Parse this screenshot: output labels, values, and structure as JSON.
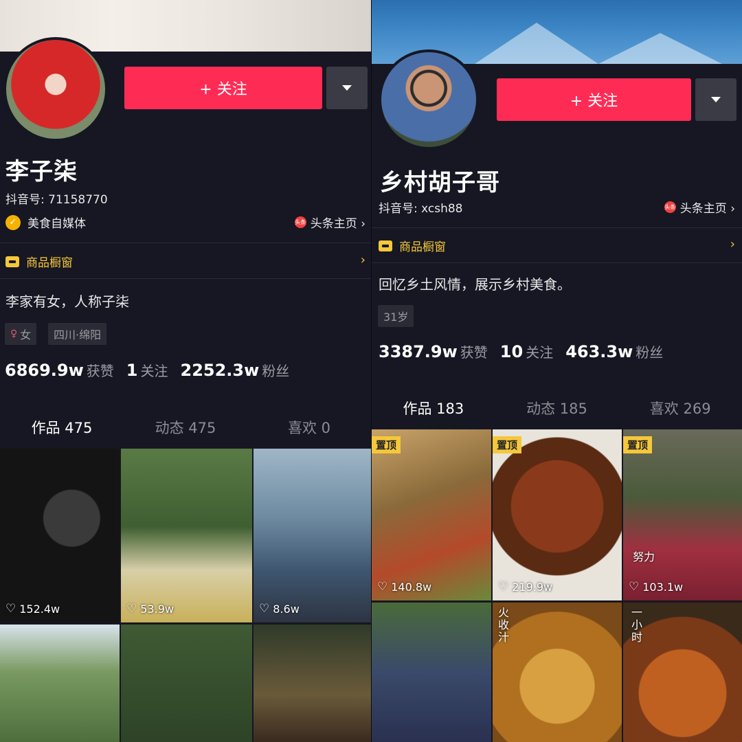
{
  "left": {
    "follow_label": "+ 关注",
    "name": "李子柒",
    "douyin_id": "抖音号: 71158770",
    "certification": "美食自媒体",
    "toutiao_label": "头条主页 ›",
    "toutiao_icon_text": "头条",
    "shop_label": "商品橱窗",
    "bio": "李家有女，人称子柒",
    "tags": [
      "女",
      "四川·绵阳"
    ],
    "stats": [
      {
        "num": "6869.9w",
        "label": "获赞"
      },
      {
        "num": "1",
        "label": "关注"
      },
      {
        "num": "2252.3w",
        "label": "粉丝"
      }
    ],
    "tabs": [
      "作品 475",
      "动态 475",
      "喜欢 0"
    ],
    "videos": [
      {
        "likes": "152.4w"
      },
      {
        "likes": "53.9w"
      },
      {
        "likes": "8.6w"
      },
      {
        "likes": ""
      },
      {
        "likes": ""
      },
      {
        "likes": ""
      }
    ]
  },
  "right": {
    "follow_label": "+ 关注",
    "name": "乡村胡子哥",
    "douyin_id": "抖音号: xcsh88",
    "toutiao_label": "头条主页 ›",
    "toutiao_icon_text": "头条",
    "shop_label": "商品橱窗",
    "bio": "回忆乡土风情，展示乡村美食。",
    "tags": [
      "31岁"
    ],
    "stats": [
      {
        "num": "3387.9w",
        "label": "获赞"
      },
      {
        "num": "10",
        "label": "关注"
      },
      {
        "num": "463.3w",
        "label": "粉丝"
      }
    ],
    "tabs": [
      "作品 183",
      "动态 185",
      "喜欢 269"
    ],
    "pin_label": "置顶",
    "videos": [
      {
        "likes": "140.8w",
        "overlay": ""
      },
      {
        "likes": "219.9w",
        "overlay": ""
      },
      {
        "likes": "103.1w",
        "overlay": "努力"
      },
      {
        "likes": "",
        "overlay": ""
      },
      {
        "likes": "",
        "overlay": "火收汁"
      },
      {
        "likes": "",
        "overlay": "一小时"
      }
    ]
  },
  "colors": {
    "accent": "#fe2c55",
    "gold": "#f5c73a",
    "bg": "#161722"
  }
}
